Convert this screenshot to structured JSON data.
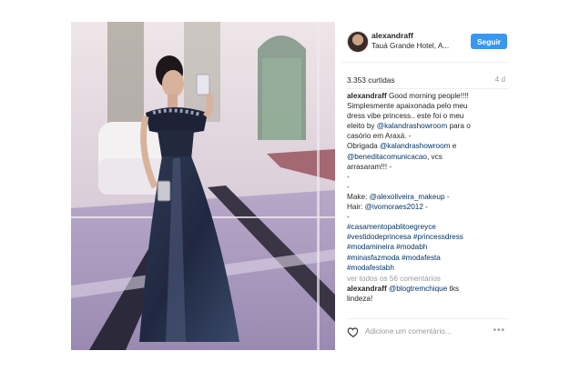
{
  "header": {
    "username": "alexandraff",
    "location": "Tauá Grande Hotel, A...",
    "follow_label": "Seguir"
  },
  "stats": {
    "likes": "3.353 curtidas",
    "age": "4 d"
  },
  "caption": {
    "username": "alexandraff",
    "lines": [
      "Good morning people!!!!",
      "Simplesmente apaixonada pelo meu",
      "dress vibe princess.. este foi o meu",
      "eleito by",
      "casório em Araxá. -",
      "Obrigada",
      "arrasaram!!! -",
      "-",
      "-"
    ],
    "mention_kalandra": "@kalandrashowroom",
    "para_o": "para o",
    "e": "e",
    "mention_benedita": "@beneditacomunicacao",
    "vcs": ", vcs",
    "make_label": "Make:",
    "make_mention": "@alexoliveira_makeup",
    "hair_label": "Hair:",
    "hair_mention": "@ivomoraes2012",
    "dash": "-",
    "hashtags": [
      "#casamentopablitoegreyce",
      "#vestidodeprincesa",
      "#princessdress",
      "#modamineira",
      "#modabh",
      "#minasfazmoda",
      "#modafesta",
      "#modafestabh"
    ]
  },
  "view_all": "ver todos os 56 comentários",
  "comment": {
    "username": "alexandraff",
    "mention": "@blogtremchique",
    "text": "tks",
    "text2": "lindeza!"
  },
  "add_comment_placeholder": "Adicione um comentário...",
  "more_icon": "•••",
  "colors": {
    "follow": "#3897f0",
    "link": "#003569",
    "muted": "#999999"
  }
}
